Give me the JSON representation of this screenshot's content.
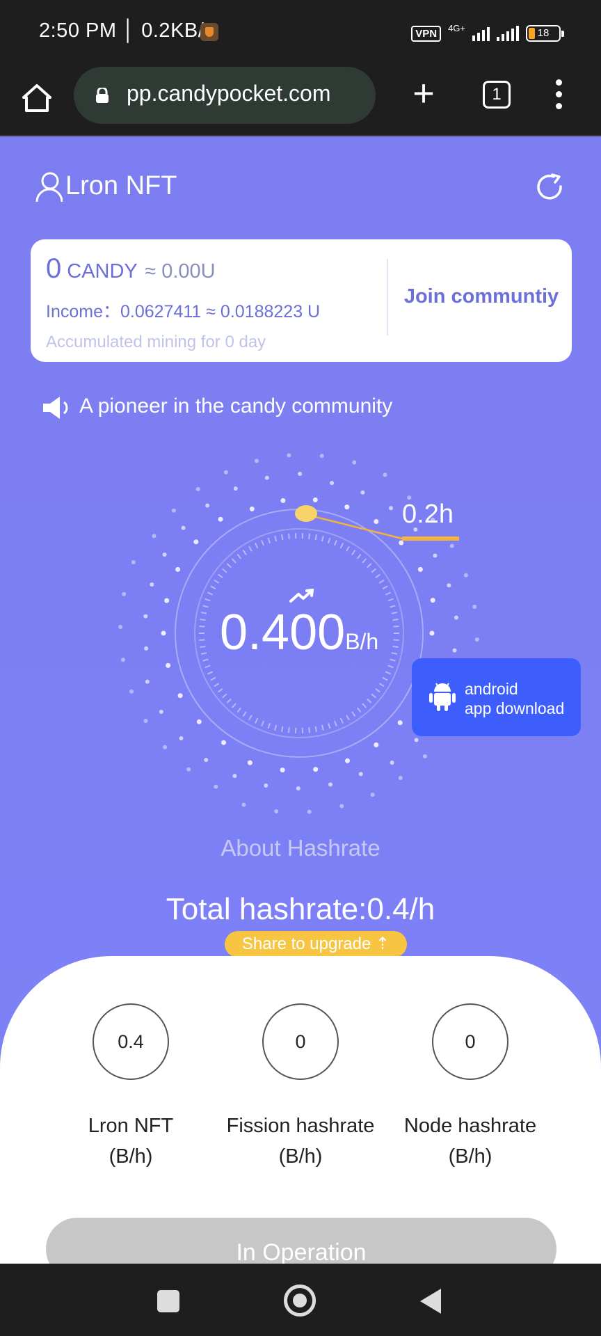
{
  "status_bar": {
    "time": "2:50 PM",
    "speed": "0.2KB/s",
    "vpn": "VPN",
    "network": "4G+",
    "battery": "18"
  },
  "browser": {
    "url": "pp.candypocket.com",
    "tab_count": "1",
    "plus": "+"
  },
  "header": {
    "title": "Lron NFT"
  },
  "candy_card": {
    "amount": "0",
    "unit": "CANDY",
    "approx": "≈ 0.00U",
    "income": "Income：0.0627411 ≈ 0.0188223 U",
    "accumulated": "Accumulated mining for 0 day",
    "join_label": "Join communtiy"
  },
  "announcement": "A pioneer in the candy community",
  "dial": {
    "hashrate_value": "0.400",
    "hashrate_unit": "B/h",
    "time_label": "0.2h"
  },
  "android_download": {
    "line1": "android",
    "line2": "app download"
  },
  "about_label": "About Hashrate",
  "total_hashrate": "Total hashrate:0.4/h",
  "share_label": "Share to upgrade ⇡",
  "stats": [
    {
      "value": "0.4",
      "label_line1": "Lron NFT",
      "label_line2": "(B/h)"
    },
    {
      "value": "0",
      "label_line1": "Fission hashrate",
      "label_line2": "(B/h)"
    },
    {
      "value": "0",
      "label_line1": "Node hashrate",
      "label_line2": "(B/h)"
    }
  ],
  "operation_label": "In Operation",
  "colors": {
    "page_bg": "#7c7df0",
    "accent_text": "#6b6fd8",
    "android_button": "#3d5efc",
    "share_button": "#f7c542",
    "progress": "#f5b33a"
  }
}
